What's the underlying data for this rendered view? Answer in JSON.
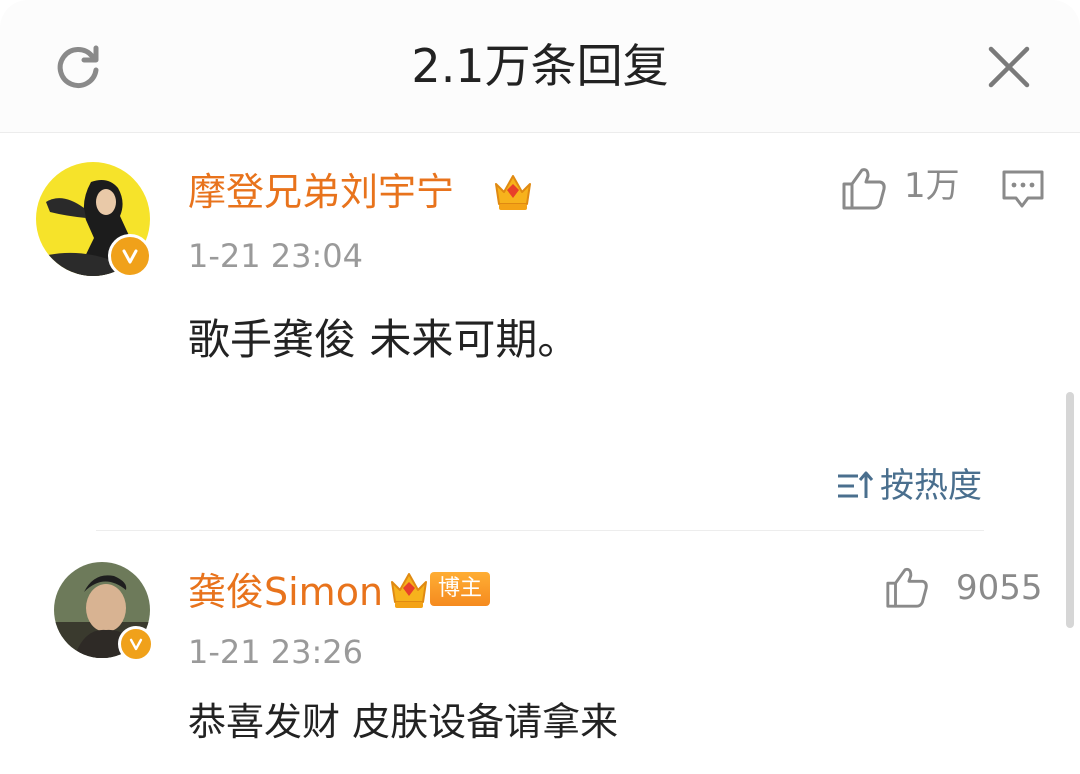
{
  "header": {
    "title": "2.1万条回复"
  },
  "comments": [
    {
      "username": "摩登兄弟刘宇宁",
      "timestamp": "1-21 23:04",
      "content": "歌手龚俊 未来可期。",
      "likes": "1万",
      "verified": true
    },
    {
      "username": "龚俊Simon",
      "badge": "博主",
      "timestamp": "1-21 23:26",
      "content": "恭喜发财 皮肤设备请拿来",
      "likes": "9055",
      "verified": true
    }
  ],
  "sort": {
    "label": "按热度"
  },
  "colors": {
    "username": "#e8731c",
    "timestamp": "#9a9a9a",
    "sort": "#4a6f8e",
    "verified_badge": "#f0a11a"
  },
  "icons": [
    "refresh-icon",
    "close-icon",
    "thumbs-up-icon",
    "reply-icon",
    "sort-icon",
    "crown-icon",
    "verified-icon"
  ]
}
